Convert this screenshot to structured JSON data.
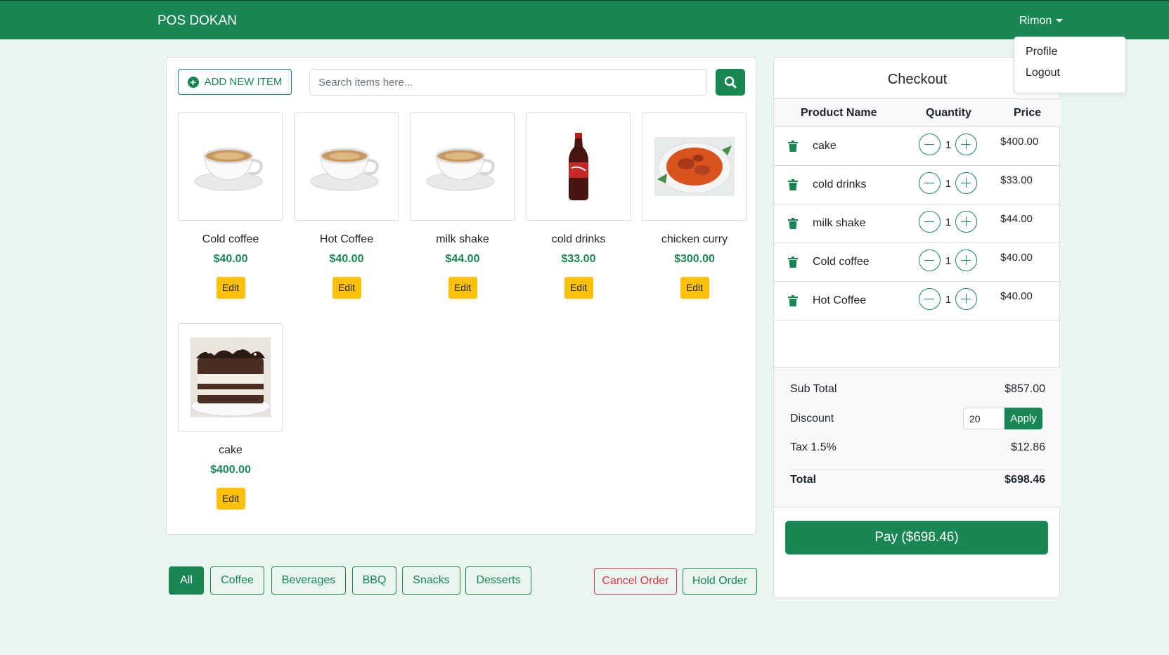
{
  "navbar": {
    "brand": "POS DOKAN",
    "user": "Rimon"
  },
  "user_menu": {
    "items": [
      "Profile",
      "Logout"
    ]
  },
  "toolbar": {
    "add_label": "ADD NEW ITEM",
    "search_placeholder": "Search items here..."
  },
  "items": [
    {
      "name": "Cold coffee",
      "price": "$40.00",
      "edit": "Edit",
      "image": "coffee-cup"
    },
    {
      "name": "Hot Coffee",
      "price": "$40.00",
      "edit": "Edit",
      "image": "coffee-cup"
    },
    {
      "name": "milk shake",
      "price": "$44.00",
      "edit": "Edit",
      "image": "coffee-cup"
    },
    {
      "name": "cold drinks",
      "price": "$33.00",
      "edit": "Edit",
      "image": "soda-bottle"
    },
    {
      "name": "chicken curry",
      "price": "$300.00",
      "edit": "Edit",
      "image": "curry-bowl"
    },
    {
      "name": "cake",
      "price": "$400.00",
      "edit": "Edit",
      "image": "cake-slice"
    }
  ],
  "categories": [
    "All",
    "Coffee",
    "Beverages",
    "BBQ",
    "Snacks",
    "Desserts"
  ],
  "active_category": "All",
  "actions": {
    "cancel": "Cancel Order",
    "hold": "Hold Order"
  },
  "checkout": {
    "title": "Checkout",
    "headers": {
      "product": "Product Name",
      "quantity": "Quantity",
      "price": "Price"
    },
    "rows": [
      {
        "name": "cake",
        "qty": "1",
        "price": "$400.00"
      },
      {
        "name": "cold drinks",
        "qty": "1",
        "price": "$33.00"
      },
      {
        "name": "milk shake",
        "qty": "1",
        "price": "$44.00"
      },
      {
        "name": "Cold coffee",
        "qty": "1",
        "price": "$40.00"
      },
      {
        "name": "Hot Coffee",
        "qty": "1",
        "price": "$40.00"
      }
    ],
    "subtotal_label": "Sub Total",
    "subtotal": "$857.00",
    "discount_label": "Discount",
    "discount_value": "20",
    "apply_label": "Apply",
    "tax_label": "Tax 1.5%",
    "tax": "$12.86",
    "total_label": "Total",
    "total": "$698.46",
    "pay_label": "Pay ($698.46)"
  },
  "colors": {
    "primary": "#198754",
    "warning": "#ffc107",
    "danger": "#dc3545",
    "background": "#e8f6ef"
  }
}
